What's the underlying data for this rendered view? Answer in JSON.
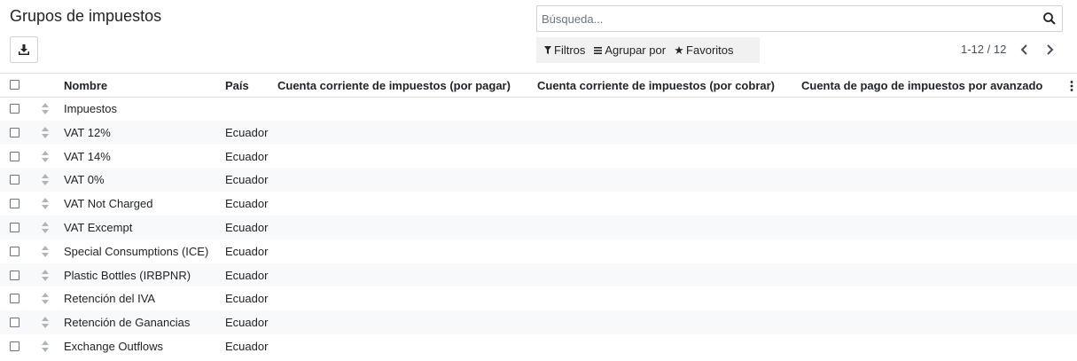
{
  "page": {
    "title": "Grupos de impuestos"
  },
  "search": {
    "placeholder": "Búsqueda...",
    "icon": "search-icon"
  },
  "toolbar": {
    "download_icon": "download-icon"
  },
  "filters": {
    "filters_label": "Filtros",
    "group_by_label": "Agrupar por",
    "favorites_label": "Favoritos"
  },
  "pager": {
    "value": "1-12 / 12"
  },
  "table": {
    "columns": {
      "name": "Nombre",
      "country": "País",
      "payable": "Cuenta corriente de impuestos (por pagar)",
      "receivable": "Cuenta corriente de impuestos (por cobrar)",
      "advance": "Cuenta de pago de impuestos por avanzado"
    },
    "rows": [
      {
        "name": "Impuestos",
        "country": ""
      },
      {
        "name": "VAT 12%",
        "country": "Ecuador"
      },
      {
        "name": "VAT 14%",
        "country": "Ecuador"
      },
      {
        "name": "VAT 0%",
        "country": "Ecuador"
      },
      {
        "name": "VAT Not Charged",
        "country": "Ecuador"
      },
      {
        "name": "VAT Excempt",
        "country": "Ecuador"
      },
      {
        "name": "Special Consumptions (ICE)",
        "country": "Ecuador"
      },
      {
        "name": "Plastic Bottles (IRBPNR)",
        "country": "Ecuador"
      },
      {
        "name": "Retención del IVA",
        "country": "Ecuador"
      },
      {
        "name": "Retención de Ganancias",
        "country": "Ecuador"
      },
      {
        "name": "Exchange Outflows",
        "country": "Ecuador"
      }
    ]
  }
}
